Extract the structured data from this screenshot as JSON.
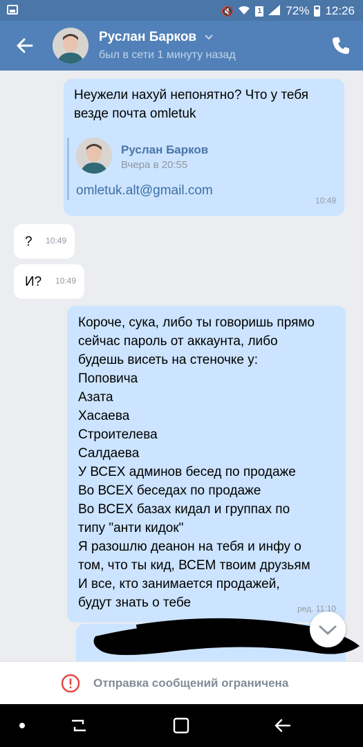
{
  "statusbar": {
    "battery": "72%",
    "time": "12:26",
    "sim_label": "1"
  },
  "header": {
    "contact_name": "Руслан Барков",
    "contact_status": "был в сети 1 минуту назад"
  },
  "messages": {
    "m1": {
      "text": "Неужели нахуй непонятно? Что у тебя везде почта omletuk",
      "forwarded": {
        "author": "Руслан Барков",
        "date": "Вчера в 20:55",
        "text": "omletuk.alt@gmail.com"
      },
      "time": "10:49"
    },
    "m2": {
      "text": "?",
      "time": "10:49"
    },
    "m3": {
      "text": "И?",
      "time": "10:49"
    },
    "m4": {
      "lines": [
        "Короче, сука, либо ты говоришь прямо",
        "сейчас пароль от аккаунта, либо",
        "будешь висеть на стеночке у:",
        "Поповича",
        "Азата",
        "Хасаева",
        "Строителева",
        "Салдаева",
        "У ВСЕХ админов бесед по продаже",
        "Во ВСЕХ беседах по продаже",
        "Во ВСЕХ базах кидал и группах по",
        "типу \"анти кидок\"",
        "Я разошлю деанон на тебя и инфу о",
        "том, что ты кид, ВСЕМ твоим друзьям",
        "И все, кто занимается продажей,",
        "будут знать о тебе"
      ],
      "time": "ред. 11:10"
    }
  },
  "restriction": {
    "text": "Отправка сообщений ограничена"
  },
  "colors": {
    "header": "#5181b8",
    "statusbar": "#4a76a8",
    "outgoing_bubble": "#cce4ff",
    "incoming_bubble": "#ffffff",
    "chat_bg": "#ebedf0",
    "warning_red": "#e64646"
  },
  "icons": {
    "back": "arrow-left",
    "chevron": "chevron-down",
    "call": "phone",
    "restriction": "exclamation-circle",
    "scroll": "chevron-down"
  }
}
